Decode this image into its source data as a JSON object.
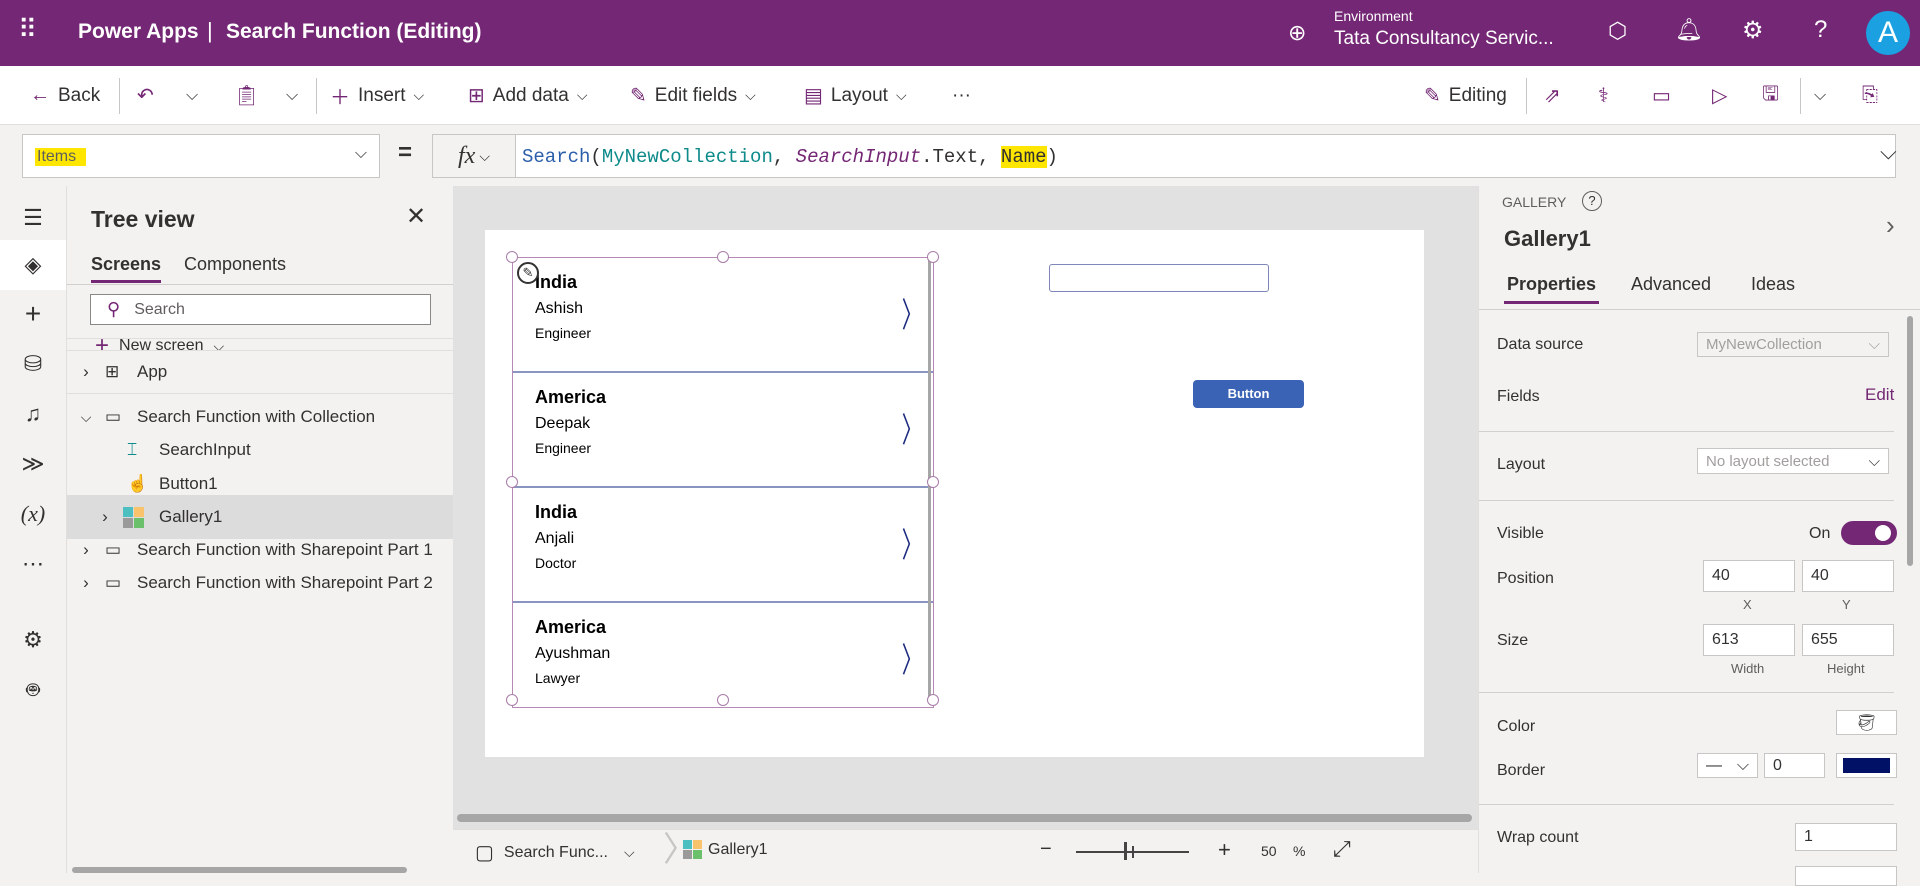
{
  "header": {
    "app": "Power Apps",
    "title": "Search Function (Editing)",
    "env_label": "Environment",
    "env_name": "Tata Consultancy Servic...",
    "avatar": "A"
  },
  "toolbar": {
    "back": "Back",
    "insert": "Insert",
    "add_data": "Add data",
    "edit_fields": "Edit fields",
    "layout": "Layout",
    "more": "···",
    "editing": "Editing"
  },
  "formula": {
    "property": "Items",
    "equals": "=",
    "fx": "fx",
    "fn": "Search",
    "p1": "MyNewCollection",
    "p2": "SearchInput",
    "p3": ".Text, ",
    "p4": "Name",
    "open": "(",
    "close": ")",
    "comma": ", "
  },
  "tree": {
    "title": "Tree view",
    "tabs": [
      "Screens",
      "Components"
    ],
    "search_placeholder": "Search",
    "new_screen": "New screen",
    "items": [
      "App",
      "Search Function with Collection",
      "SearchInput",
      "Button1",
      "Gallery1",
      "Search Function with Sharepoint Part 1",
      "Search Function with Sharepoint Part 2"
    ]
  },
  "gallery": [
    {
      "country": "India",
      "name": "Ashish",
      "job": "Engineer"
    },
    {
      "country": "America",
      "name": "Deepak",
      "job": "Engineer"
    },
    {
      "country": "India",
      "name": "Anjali",
      "job": "Doctor"
    },
    {
      "country": "America",
      "name": "Ayushman",
      "job": "Lawyer"
    }
  ],
  "canvas": {
    "button_label": "Button"
  },
  "status": {
    "screen": "Search Func...",
    "control": "Gallery1",
    "zoom": "50",
    "pct": "%",
    "zoom_fraction": 0.5
  },
  "panel": {
    "type": "GALLERY",
    "name": "Gallery1",
    "tabs": [
      "Properties",
      "Advanced",
      "Ideas"
    ],
    "data_source_label": "Data source",
    "data_source": "MyNewCollection",
    "fields_label": "Fields",
    "fields_edit": "Edit",
    "layout_label": "Layout",
    "layout_value": "No layout selected",
    "visible_label": "Visible",
    "visible_value": "On",
    "position_label": "Position",
    "x": "40",
    "y": "40",
    "x_label": "X",
    "y_label": "Y",
    "size_label": "Size",
    "width": "613",
    "height": "655",
    "width_label": "Width",
    "height_label": "Height",
    "color_label": "Color",
    "border_label": "Border",
    "border_width": "0",
    "border_color": "#001166",
    "wrap_label": "Wrap count",
    "wrap": "1"
  },
  "colors": {
    "brand": "#742774",
    "button": "#3b63b5"
  }
}
